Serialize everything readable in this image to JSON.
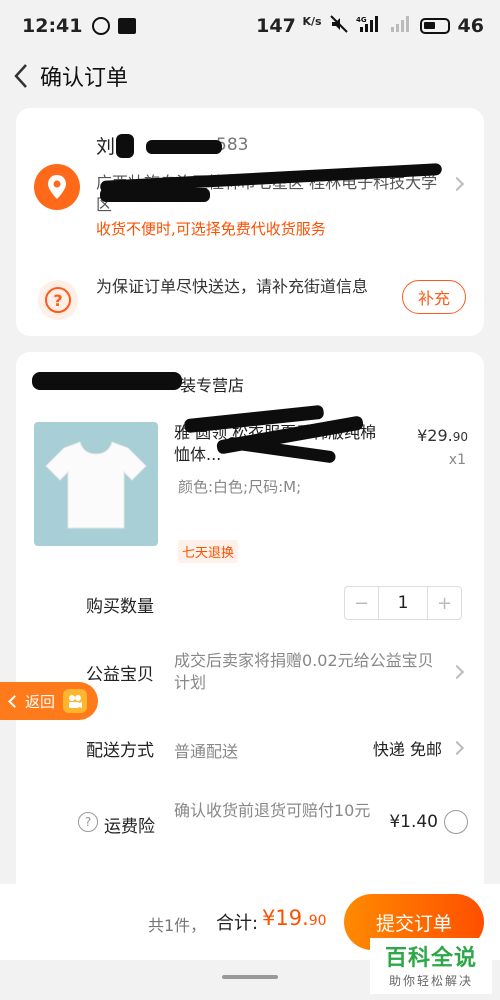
{
  "status_bar": {
    "time": "12:41",
    "speed": "147",
    "speed_unit": "K/s",
    "network": "4G",
    "battery": "46"
  },
  "nav": {
    "title": "确认订单"
  },
  "address": {
    "name": "刘",
    "phone_tail": "583",
    "detail": "广西壮族自治区桂林市七星区 桂林电子科技大学",
    "detail_tail": "区",
    "collect_tip": "收货不便时,可选择免费代收货服务",
    "street_tip": "为保证订单尽快送达，请补充街道信息",
    "supplement_label": "补充"
  },
  "order": {
    "store_name": "装专营店",
    "product": {
      "title": "雅 圆领 松衣服夏季韩版纯棉 恤体...",
      "sku": "颜色:白色;尺码:M;",
      "return_tag": "七天退换",
      "price_main": "¥29.",
      "price_decimal": "90",
      "quantity_label": "x1"
    },
    "quantity": {
      "label": "购买数量",
      "minus": "−",
      "value": "1",
      "plus": "+"
    },
    "charity": {
      "label": "公益宝贝",
      "text": "成交后卖家将捐赠0.02元给公益宝贝计划"
    },
    "delivery": {
      "label": "配送方式",
      "value": "普通配送",
      "right": "快递 免邮"
    },
    "insurance": {
      "label": "运费险",
      "text": "确认收货前退货可赔付10元",
      "price": "¥1.40"
    }
  },
  "float_back": {
    "label": "返回"
  },
  "bottom": {
    "count_text": "共1件，",
    "total_label": "合计:",
    "total_main": "¥19.",
    "total_decimal": "90",
    "submit_label": "提交订单"
  },
  "watermark": {
    "main": "百科全说",
    "sub": "助你轻松解决"
  },
  "colors": {
    "accent": "#ff4f00",
    "accent_gradient_start": "#ff8a00",
    "watermark_green": "#2da848"
  }
}
